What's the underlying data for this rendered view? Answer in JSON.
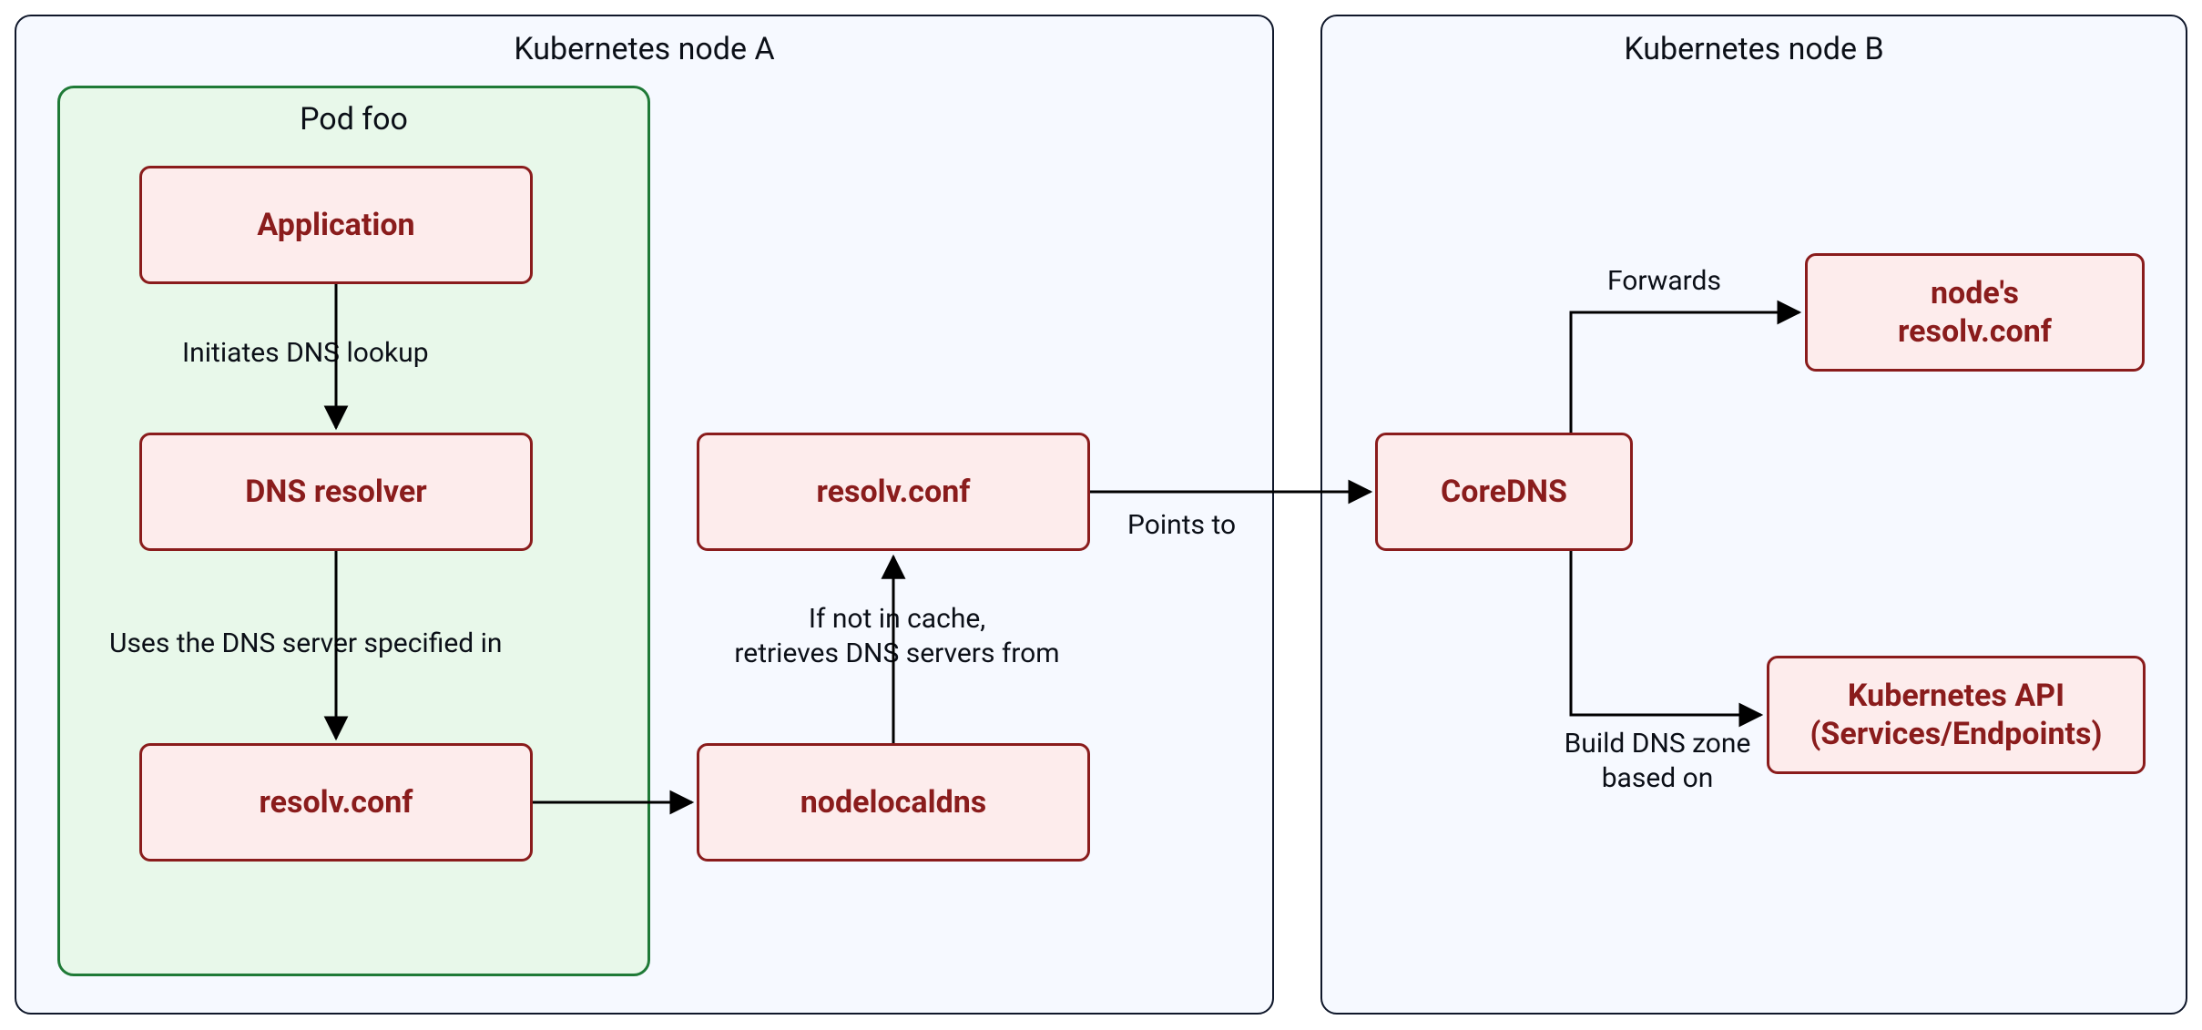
{
  "nodeA": {
    "title": "Kubernetes node A"
  },
  "nodeB": {
    "title": "Kubernetes node B"
  },
  "pod": {
    "title": "Pod foo"
  },
  "boxes": {
    "application": "Application",
    "dns_resolver": "DNS resolver",
    "pod_resolvconf": "resolv.conf",
    "nodelocaldns": "nodelocaldns",
    "nld_resolvconf": "resolv.conf",
    "coredns": "CoreDNS",
    "node_resolvconf": "node's\nresolv.conf",
    "k8s_api": "Kubernetes API\n(Services/Endpoints)"
  },
  "edges": {
    "app_to_resolver": "Initiates DNS lookup",
    "resolver_to_resolv": "Uses the DNS server specified in",
    "nld_to_resolv": "If not in cache,\nretrieves DNS servers from",
    "resolv_to_coredns": "Points to",
    "coredns_to_noderesolv": "Forwards",
    "coredns_to_k8sapi": "Build DNS zone\nbased on"
  },
  "colors": {
    "box_border": "#8a1c1c",
    "box_fill": "#fdecec",
    "pod_border": "#1f7a37",
    "pod_fill": "#e8f8ea",
    "node_border": "#0f172a",
    "node_fill": "#f6f9ff"
  }
}
